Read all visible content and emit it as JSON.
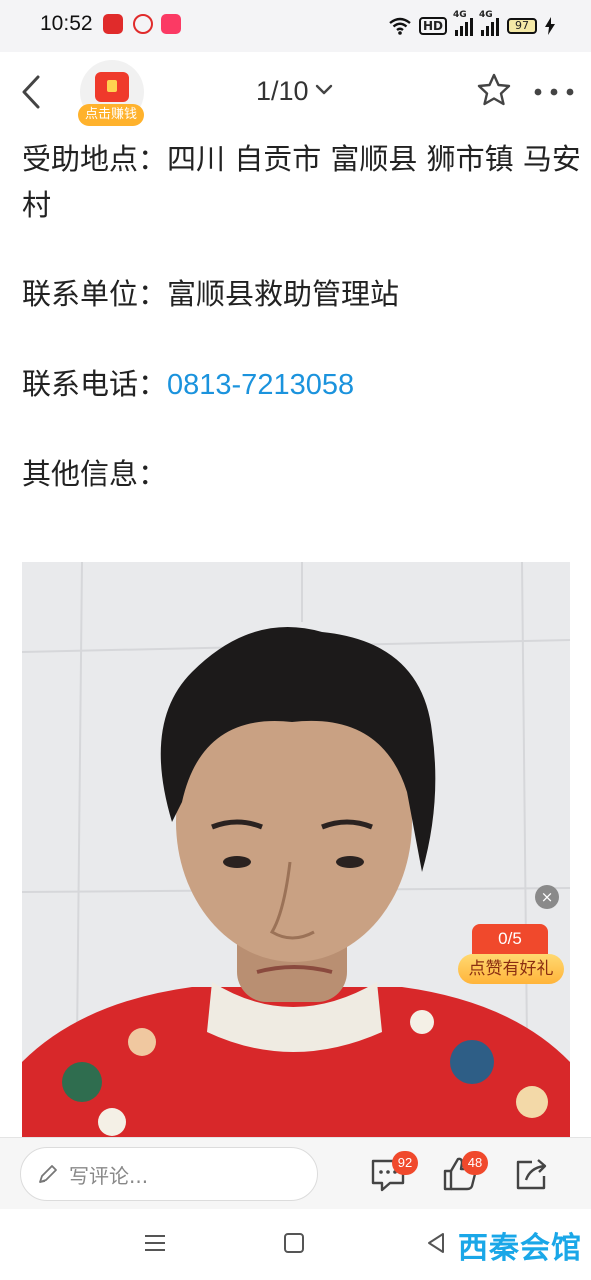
{
  "status_bar": {
    "time": "10:52",
    "hd_label": "HD",
    "net1": "4G",
    "net2": "4G",
    "battery": "97"
  },
  "header": {
    "earn_label": "点击赚钱",
    "page_indicator": "1/10"
  },
  "content": {
    "location_line": "受助地点：四川 自贡市 富顺县 狮市镇 马安村",
    "unit_label": "联系单位：",
    "unit_value": "富顺县救助管理站",
    "phone_label": "联系电话：",
    "phone_value": "0813-7213058",
    "other_label": "其他信息："
  },
  "like_badge": {
    "close": "×",
    "count": "0/5",
    "label": "点赞有好礼"
  },
  "action_bar": {
    "comment_placeholder": "写评论...",
    "comment_count": "92",
    "like_count": "48"
  },
  "watermark": "西秦会馆",
  "colors": {
    "link": "#1b93dd",
    "badge": "#f0492c",
    "earn": "#ffb22c"
  }
}
